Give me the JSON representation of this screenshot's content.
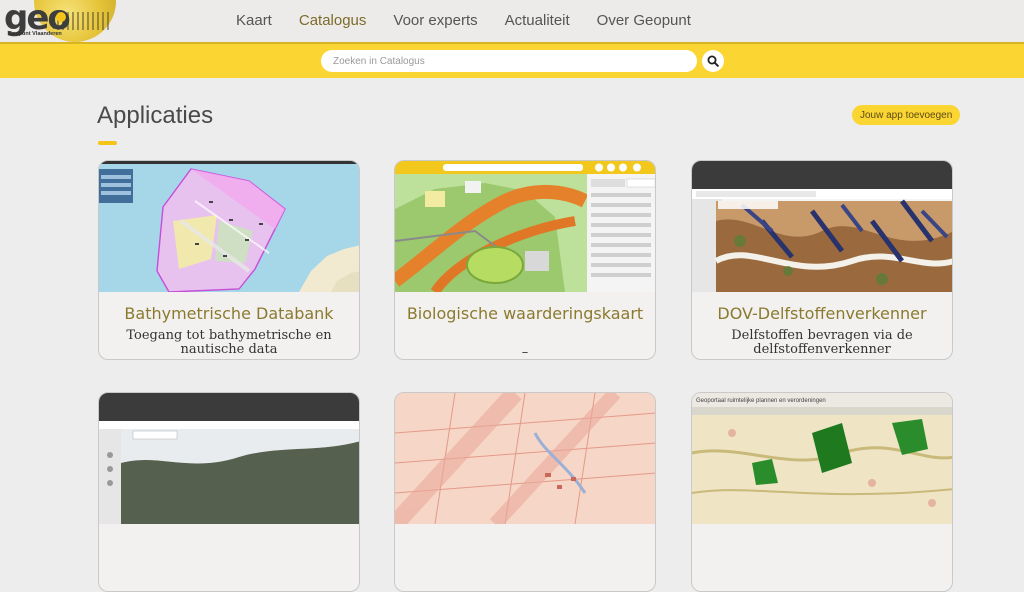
{
  "logo": {
    "word": "geo",
    "subtitle": "Geopunt Vlaanderen"
  },
  "nav": [
    {
      "label": "Kaart"
    },
    {
      "label": "Catalogus",
      "active": true
    },
    {
      "label": "Voor experts"
    },
    {
      "label": "Actualiteit"
    },
    {
      "label": "Over Geopunt"
    }
  ],
  "search": {
    "placeholder": "Zoeken in Catalogus"
  },
  "page": {
    "title": "Applicaties",
    "add_button": "Jouw app toevoegen"
  },
  "cards": [
    {
      "title": "Bathymetrische Databank",
      "description": "Toegang tot bathymetrische en nautische data"
    },
    {
      "title": "Biologische waarderingskaart",
      "description": "–"
    },
    {
      "title": "DOV-Delfstoffenverkenner",
      "description": "Delfstoffen bevragen via de delfstoffenverkenner"
    },
    {
      "title": "",
      "description": ""
    },
    {
      "title": "",
      "description": ""
    },
    {
      "title": "",
      "description": "",
      "thumb_text": "Geoportaal ruimtelijke plannen en verordeningen"
    }
  ],
  "colors": {
    "accent": "#fbd531",
    "title": "#8b7a2e",
    "nav_active": "#7d6b2a"
  }
}
